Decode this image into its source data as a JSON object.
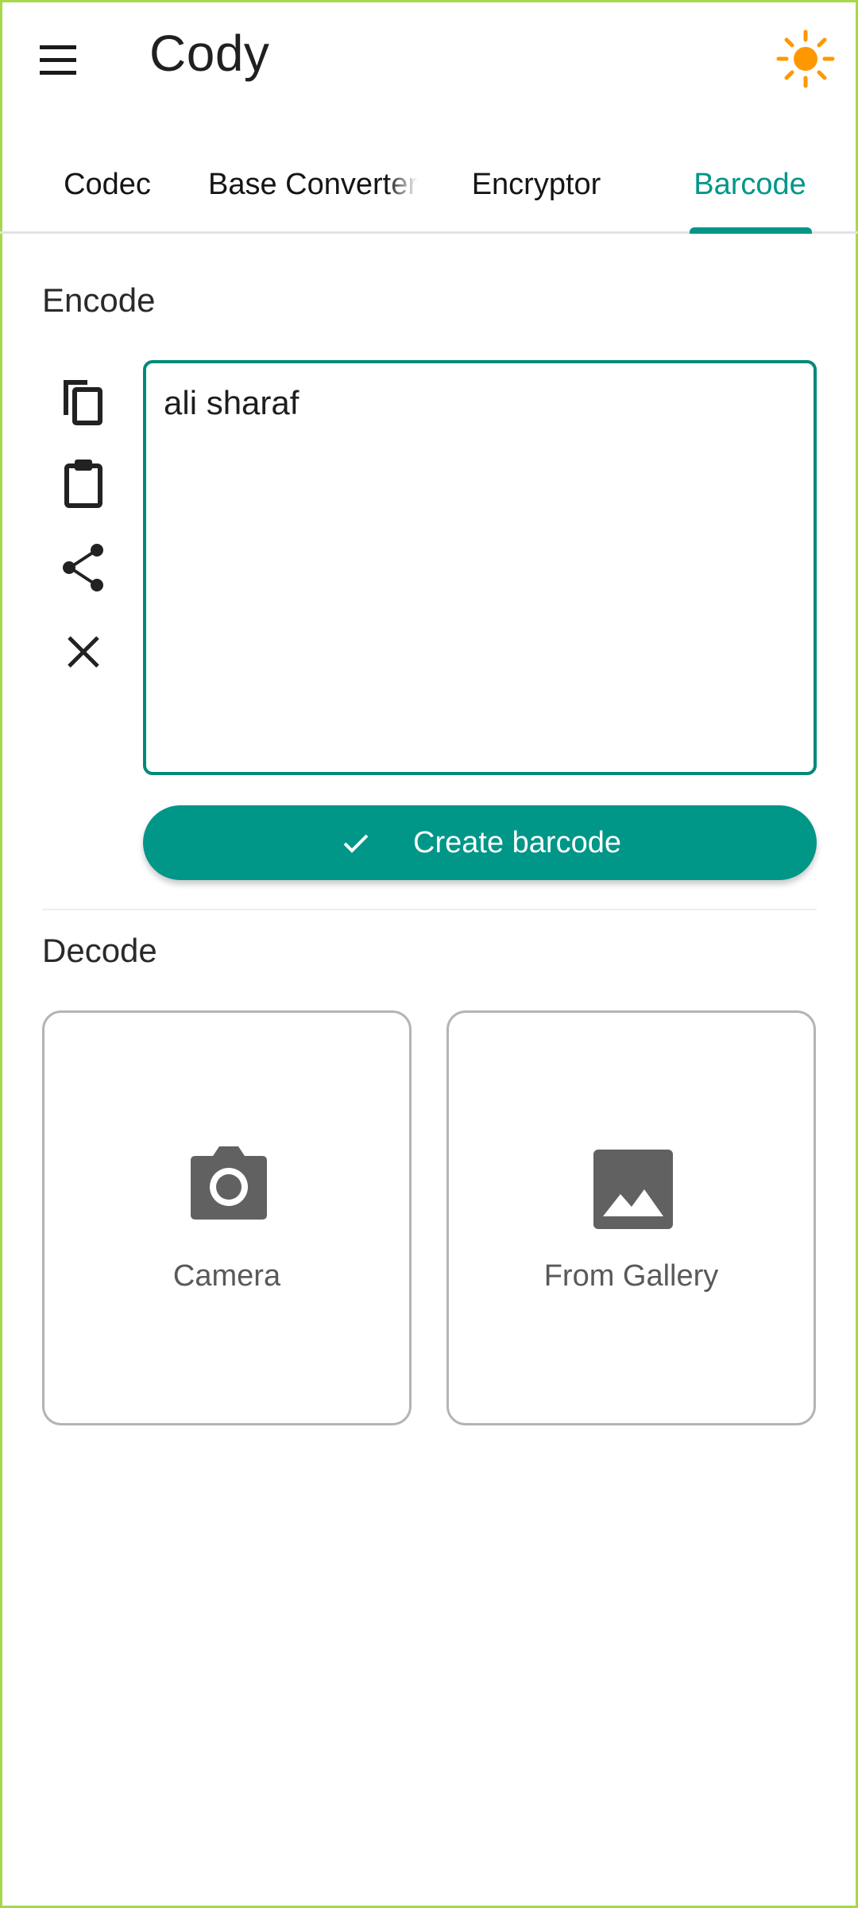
{
  "app": {
    "title": "Cody",
    "menu_icon": "menu-icon",
    "theme_icon": "sun-icon",
    "accent_color": "#009688",
    "theme_icon_color": "#ff9800"
  },
  "tabs": [
    {
      "label": "Codec",
      "selected": false
    },
    {
      "label": "Base Converter",
      "selected": false
    },
    {
      "label": "Encryptor",
      "selected": false
    },
    {
      "label": "Barcode",
      "selected": true
    }
  ],
  "encode": {
    "title": "Encode",
    "input_value": "ali sharaf",
    "actions": [
      "copy-icon",
      "paste-icon",
      "share-icon",
      "clear-icon"
    ],
    "create_button_label": "Create barcode"
  },
  "decode": {
    "title": "Decode",
    "camera_label": "Camera",
    "gallery_label": "From Gallery"
  }
}
